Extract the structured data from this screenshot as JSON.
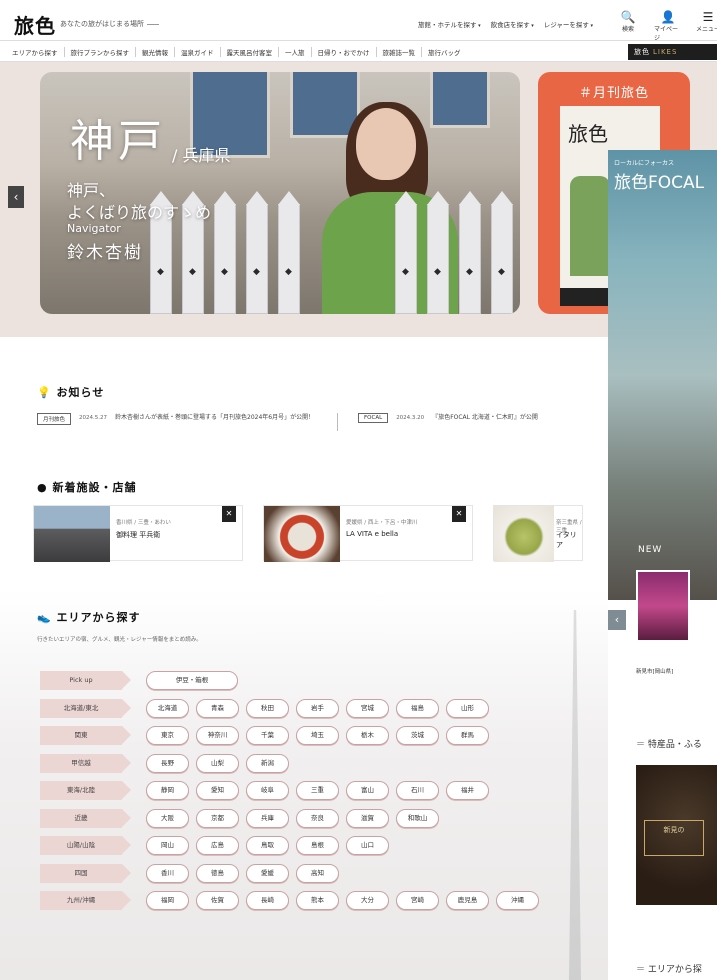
{
  "header": {
    "logo": "旅色",
    "tagline": "あなたの旅がはじまる場所",
    "links": [
      "旅館・ホテルを探す",
      "飲食店を探す",
      "レジャーを探す"
    ],
    "icons": [
      {
        "icon": "search-icon",
        "glyph": "🔍",
        "label": "検索"
      },
      {
        "icon": "user-icon",
        "glyph": "👤",
        "label": "マイページ"
      },
      {
        "icon": "menu-icon",
        "glyph": "☰",
        "label": "メニュー"
      }
    ]
  },
  "nav": {
    "items": [
      "エリアから探す",
      "旅行プランから探す",
      "観光情報",
      "温泉ガイド",
      "露天風呂付客室",
      "一人旅",
      "日帰り・おでかけ",
      "旅雑誌一覧",
      "旅行バッグ"
    ],
    "likes": "旅色",
    "likes_accent": "LIKES"
  },
  "hero": {
    "title": "神戸",
    "pref": "兵庫県",
    "subtitle_1": "神戸、",
    "subtitle_2": "よくばり旅のすゝめ",
    "navigator_label": "Navigator",
    "navigator_name": "鈴木杏樹",
    "arrow": "‹"
  },
  "magazine": {
    "title": "＃月刊旅色",
    "cover_title": "旅色"
  },
  "focal": {
    "label": "ローカルにフォーカス",
    "title": "旅色FOCAL",
    "new_badge": "NEW",
    "arrow": "‹",
    "caption": "新見市[岡山県]",
    "section1": "特産品・ふる",
    "image_text": "新見の",
    "section2": "エリアから探"
  },
  "news": {
    "heading": "お知らせ",
    "items": [
      {
        "tag": "月刊旅色",
        "date": "2024.5.27",
        "text": "鈴木杏樹さんが表紙・巻頭に登場する「月刊旅色2024年6月号」が公開！"
      },
      {
        "tag": "FOCAL",
        "date": "2024.3.20",
        "text": "『旅色FOCAL 北海道・仁木町』が公開"
      }
    ]
  },
  "facilities": {
    "heading": "新着施設・店舗",
    "items": [
      {
        "category": "香川県 / 三豊・あわい",
        "name": "御料理 平兵衛",
        "bookmark": "✕"
      },
      {
        "category": "愛媛県 / 西上・下呂・中津川",
        "name": "LA VITA e bella",
        "bookmark": "✕"
      },
      {
        "category": "奈三重県 / 三重",
        "name": "イタリア",
        "bookmark": "✕"
      }
    ]
  },
  "area": {
    "heading": "エリアから探す",
    "description": "行きたいエリアの宿、グルメ、観光・レジャー情報をまとめ読み。",
    "rows": [
      {
        "region": "Pick up",
        "prefs": [
          "伊豆・箱根"
        ]
      },
      {
        "region": "北海道/東北",
        "prefs": [
          "北海道",
          "青森",
          "秋田",
          "岩手",
          "宮城",
          "福島",
          "山形"
        ]
      },
      {
        "region": "関東",
        "prefs": [
          "東京",
          "神奈川",
          "千葉",
          "埼玉",
          "栃木",
          "茨城",
          "群馬"
        ]
      },
      {
        "region": "甲信越",
        "prefs": [
          "長野",
          "山梨",
          "新潟"
        ]
      },
      {
        "region": "東海/北陸",
        "prefs": [
          "静岡",
          "愛知",
          "岐阜",
          "三重",
          "富山",
          "石川",
          "福井"
        ]
      },
      {
        "region": "近畿",
        "prefs": [
          "大阪",
          "京都",
          "兵庫",
          "奈良",
          "滋賀",
          "和歌山"
        ]
      },
      {
        "region": "山陽/山陰",
        "prefs": [
          "岡山",
          "広島",
          "鳥取",
          "島根",
          "山口"
        ]
      },
      {
        "region": "四国",
        "prefs": [
          "香川",
          "徳島",
          "愛媛",
          "高知"
        ]
      },
      {
        "region": "九州/沖縄",
        "prefs": [
          "福岡",
          "佐賀",
          "長崎",
          "熊本",
          "大分",
          "宮崎",
          "鹿児島",
          "沖縄"
        ]
      }
    ]
  }
}
